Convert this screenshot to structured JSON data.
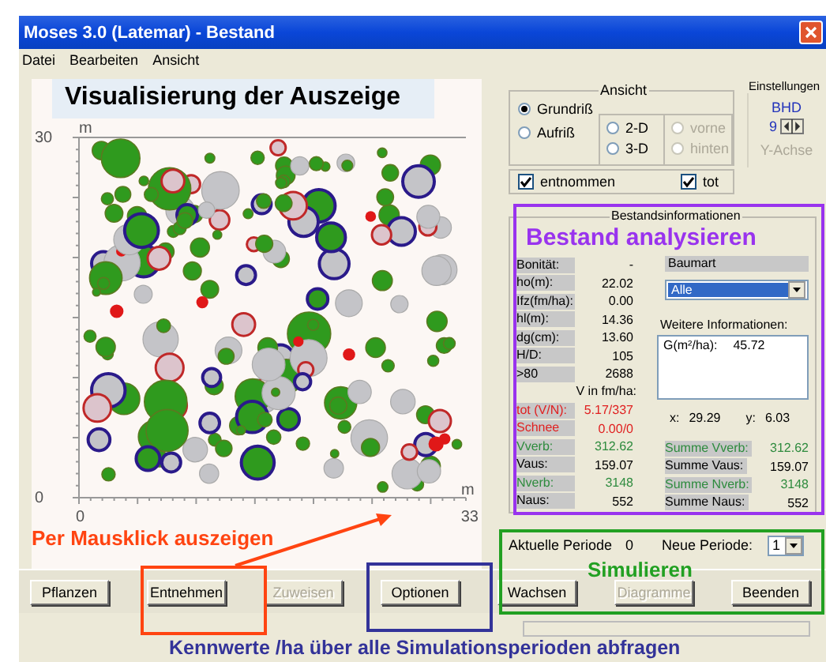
{
  "window": {
    "title": "Moses 3.0 (Latemar) - Bestand"
  },
  "menu": [
    "Datei",
    "Bearbeiten",
    "Ansicht"
  ],
  "plot": {
    "heading": "Visualisierung der Auszeige",
    "y_unit": "m",
    "y_max": "30",
    "y_min": "0",
    "x_min": "0",
    "x_max": "33",
    "x_unit": "m"
  },
  "view": {
    "title": "Ansicht",
    "projection": [
      {
        "label": "Grundriß",
        "selected": true
      },
      {
        "label": "Aufriß",
        "selected": false
      }
    ],
    "dimension": [
      {
        "label": "2-D",
        "selected": false,
        "disabled": false
      },
      {
        "label": "3-D",
        "selected": false,
        "disabled": false
      }
    ],
    "side": [
      {
        "label": "vorne",
        "selected": false,
        "disabled": true
      },
      {
        "label": "hinten",
        "selected": false,
        "disabled": true
      }
    ]
  },
  "settings": {
    "title": "Einstellungen",
    "label": "BHD",
    "value": "9",
    "axis": "Y-Achse"
  },
  "filters": [
    {
      "label": "entnommen",
      "checked": true
    },
    {
      "label": "tot",
      "checked": true
    }
  ],
  "stand_info": {
    "title": "Bestandsinformationen",
    "rows": [
      {
        "label": "Bonität:",
        "value": "-",
        "color": "#000000"
      },
      {
        "label": "ho(m):",
        "value": "22.02",
        "color": "#000000"
      },
      {
        "label": "Ifz(fm/ha):",
        "value": "0.00",
        "color": "#000000"
      },
      {
        "label": "hl(m):",
        "value": "14.36",
        "color": "#000000"
      },
      {
        "label": "dg(cm):",
        "value": "13.60",
        "color": "#000000"
      },
      {
        "label": "H/D:",
        "value": "105",
        "color": "#000000"
      },
      {
        "label": ">80",
        "value": "2688",
        "color": "#000000"
      }
    ],
    "volume_heading": "V in fm/ha:",
    "volume_rows": [
      {
        "label": "tot (V/N):",
        "value": "5.17/337",
        "color": "#e02020"
      },
      {
        "label": "Schnee",
        "value": "0.00/0",
        "color": "#e02020"
      },
      {
        "label": "Vverb:",
        "value": "312.62",
        "color": "#2e8b3e"
      },
      {
        "label": "Vaus:",
        "value": "159.07",
        "color": "#000000"
      },
      {
        "label": "Nverb:",
        "value": "3148",
        "color": "#2e8b3e"
      },
      {
        "label": "Naus:",
        "value": "552",
        "color": "#000000"
      }
    ],
    "species_label": "Baumart",
    "species": "Alle",
    "more_label": "Weitere Informationen:",
    "more": {
      "key": "G(m²/ha):",
      "value": "45.72"
    },
    "coords": [
      {
        "label": "x:",
        "value": "29.29"
      },
      {
        "label": "y:",
        "value": "6.03"
      }
    ],
    "sums": [
      {
        "label": "Summe Vverb:",
        "value": "312.62",
        "color": "#2e8b3e"
      },
      {
        "label": "Summe Vaus:",
        "value": "159.07",
        "color": "#000000"
      },
      {
        "label": "Summe Nverb:",
        "value": "3148",
        "color": "#2e8b3e"
      },
      {
        "label": "Summe Naus:",
        "value": "552",
        "color": "#000000"
      }
    ]
  },
  "period": {
    "current_label": "Aktuelle Periode",
    "current": "0",
    "new_label": "Neue Periode:",
    "new": "1"
  },
  "buttons": [
    {
      "label": "Pflanzen",
      "disabled": false
    },
    {
      "label": "Entnehmen",
      "disabled": false
    },
    {
      "label": "Zuweisen",
      "disabled": true
    },
    {
      "label": "Optionen",
      "disabled": false
    },
    {
      "label": "Wachsen",
      "disabled": false
    },
    {
      "label": "Diagramme",
      "disabled": true
    },
    {
      "label": "Beenden",
      "disabled": false
    }
  ],
  "progress": {
    "level": 0
  },
  "annotations": [
    {
      "kind": "analyze",
      "text": "Bestand analysieren",
      "color": "#9933ee"
    },
    {
      "kind": "simulate",
      "text": "Simulieren",
      "color": "#22a022"
    },
    {
      "kind": "mark",
      "text": "Per Mausklick auszeigen",
      "color": "#ff4411"
    },
    {
      "kind": "query",
      "text": "Kennwerte /ha  über alle Simulationsperioden abfragen",
      "color": "#333399"
    }
  ]
}
